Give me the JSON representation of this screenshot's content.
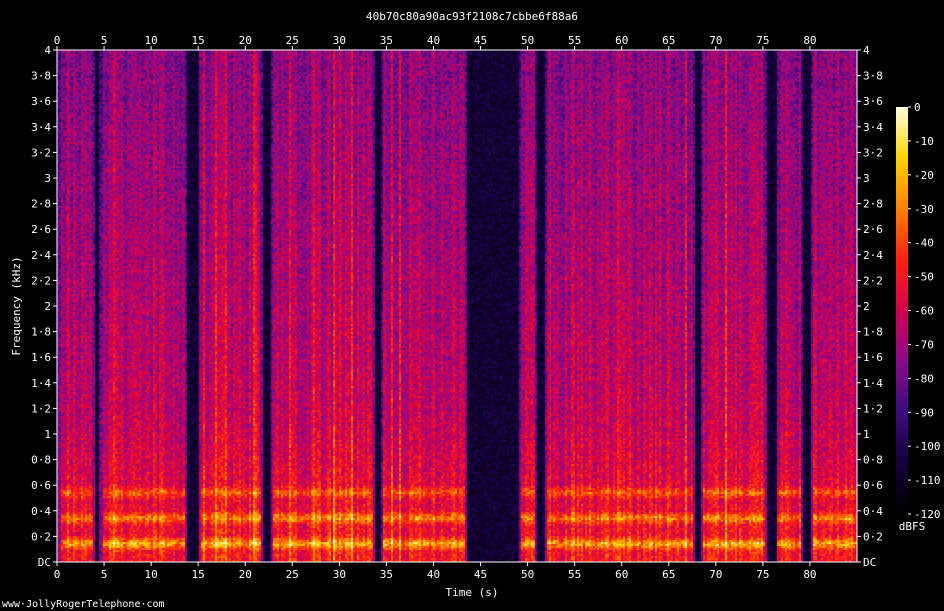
{
  "chart_data": {
    "type": "heatmap",
    "title": "40b70c80a90ac93f2108c7cbbe6f88a6",
    "xlabel": "Time (s)",
    "ylabel": "Frequency (kHz)",
    "xlim": [
      0,
      85
    ],
    "ylim": [
      0,
      4
    ],
    "x_ticks": [
      0,
      5,
      10,
      15,
      20,
      25,
      30,
      35,
      40,
      45,
      50,
      55,
      60,
      65,
      70,
      75,
      80
    ],
    "x_tick_labels": [
      "0",
      "5",
      "10",
      "15",
      "20",
      "25",
      "30",
      "35",
      "40",
      "45",
      "50",
      "55",
      "60",
      "65",
      "70",
      "75",
      "80"
    ],
    "y_ticks": [
      0,
      0.2,
      0.4,
      0.6,
      0.8,
      1,
      1.2,
      1.4,
      1.6,
      1.8,
      2,
      2.2,
      2.4,
      2.6,
      2.8,
      3,
      3.2,
      3.4,
      3.6,
      3.8,
      4
    ],
    "y_tick_labels": [
      "DC",
      "0·2",
      "0·4",
      "0·6",
      "0·8",
      "1",
      "1·2",
      "1·4",
      "1·6",
      "1·8",
      "2",
      "2·2",
      "2·4",
      "2·6",
      "2·8",
      "3",
      "3·2",
      "3·4",
      "3·6",
      "3·8",
      "4"
    ],
    "colorbar": {
      "label": "dBFS",
      "range": [
        -120,
        0
      ],
      "ticks": [
        0,
        -10,
        -20,
        -30,
        -40,
        -50,
        -60,
        -70,
        -80,
        -90,
        -100,
        -110,
        -120
      ],
      "tick_labels": [
        "0",
        "-10",
        "-20",
        "-30",
        "-40",
        "-50",
        "-60",
        "-70",
        "-80",
        "-90",
        "-100",
        "-110",
        "-120"
      ],
      "colormap": [
        "#000000",
        "#14003a",
        "#3a0a80",
        "#8a0a8a",
        "#d40050",
        "#ff2010",
        "#ff8000",
        "#ffd400",
        "#ffffe0"
      ]
    },
    "silent_intervals_s": [
      [
        3.9,
        4.4
      ],
      [
        13.8,
        15.0
      ],
      [
        21.8,
        22.6
      ],
      [
        33.6,
        34.3
      ],
      [
        43.5,
        49.0
      ],
      [
        50.8,
        51.8
      ],
      [
        67.6,
        68.3
      ],
      [
        75.3,
        76.3
      ],
      [
        79.2,
        79.9
      ]
    ],
    "voiced_segments_s": [
      [
        0.3,
        3.8
      ],
      [
        4.8,
        13.5
      ],
      [
        15.2,
        21.5
      ],
      [
        22.8,
        33.4
      ],
      [
        34.5,
        43.3
      ],
      [
        49.2,
        50.6
      ],
      [
        52.0,
        67.4
      ],
      [
        68.5,
        75.2
      ],
      [
        76.5,
        79.0
      ],
      [
        80.2,
        84.8
      ]
    ],
    "formant_bands_khz": [
      0.15,
      0.35,
      0.55
    ],
    "grid": false
  },
  "watermark": "www·JollyRogerTelephone·com"
}
